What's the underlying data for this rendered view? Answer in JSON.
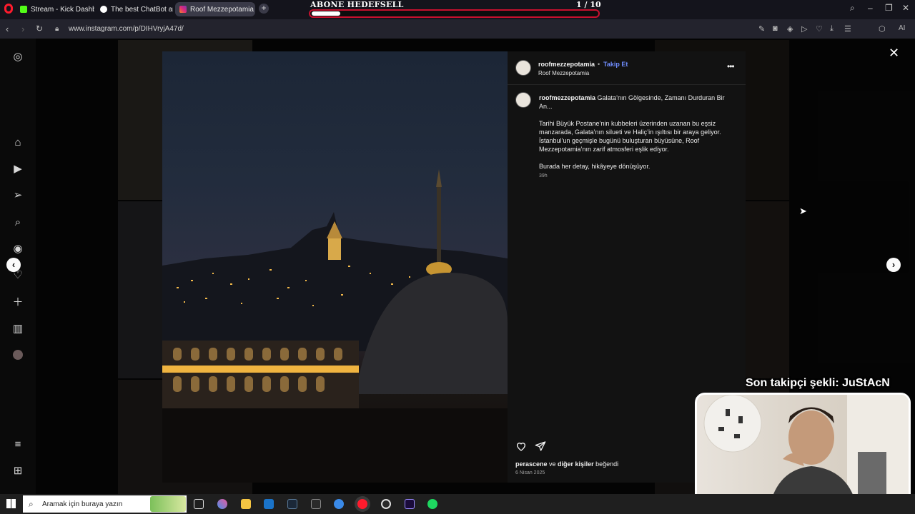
{
  "browser": {
    "tabs": [
      {
        "label": "Stream - Kick Dashboard",
        "favicon_color": "#53fc18"
      },
      {
        "label": "The best ChatBot and W",
        "favicon_color": "#ffffff"
      },
      {
        "label": "Roof Mezzepotamia (@ro",
        "favicon_color": "#d6249f",
        "active": true
      }
    ],
    "url": "www.instagram.com/p/DIHVryjA47d/",
    "ai_label": "AI"
  },
  "overlay": {
    "goal_title": "ABONE HEDEFSELL",
    "goal_count": "1  / 10",
    "goal_progress": 0.1,
    "goal_color": "#c8102e",
    "follower_text": "Son takipçi şekli: JuStAcN"
  },
  "post": {
    "username": "roofmezzepotamia",
    "follow_label": "Takip Et",
    "follow_dot": "•",
    "display_name": "Roof Mezzepotamia",
    "caption_username": "roofmezzepotamia",
    "caption_title": " Galata’nın Gölgesinde, Zamanı Durduran Bir An...",
    "caption_p1": "Tarihi Büyük Postane’nin kubbeleri üzerinden uzanan bu eşsiz manzarada, Galata’nın silueti ve Haliç’in ışıltısı bir araya geliyor. İstanbul’un geçmişle bugünü buluşturan büyüsüne, Roof Mezzepotamia’nın zarif atmosferi eşlik ediyor.",
    "caption_p2": "Burada her detay, hikâyeye dönüşüyor.",
    "caption_time": "39h",
    "likes_user": "perascene",
    "likes_connector": " ve ",
    "likes_others": "diğer kişiler",
    "likes_suffix": " beğendi",
    "date": "6 Nisan 2025",
    "link_color": "#708dff"
  },
  "taskbar": {
    "search_placeholder": "Aramak için buraya yazın"
  }
}
